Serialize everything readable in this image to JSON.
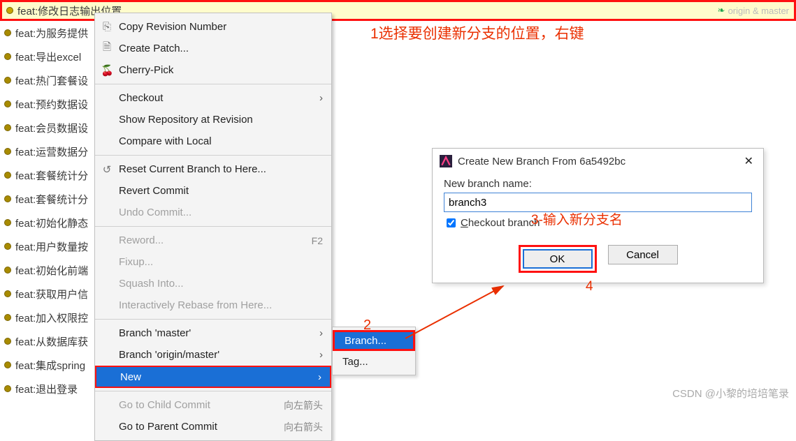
{
  "commits": [
    "feat:修改日志输出位置",
    "feat:为服务提供",
    "feat:导出excel",
    "feat:热门套餐设",
    "feat:预约数据设",
    "feat:会员数据设",
    "feat:运营数据分",
    "feat:套餐统计分",
    "feat:套餐统计分",
    "feat:初始化静态",
    "feat:用户数量按",
    "feat:初始化前端",
    "feat:获取用户信",
    "feat:加入权限控",
    "feat:从数据库获",
    "feat:集成spring",
    "feat:退出登录"
  ],
  "branch_tag": "origin & master",
  "annotations": {
    "a1": "1选择要创建新分支的位置，右键",
    "a2": "2",
    "a3": "3-输入新分支名",
    "a4": "4"
  },
  "menu": {
    "copy_revision": "Copy Revision Number",
    "create_patch": "Create Patch...",
    "cherry_pick": "Cherry-Pick",
    "checkout": "Checkout",
    "show_repo": "Show Repository at Revision",
    "compare_local": "Compare with Local",
    "reset_branch": "Reset Current Branch to Here...",
    "revert_commit": "Revert Commit",
    "undo_commit": "Undo Commit...",
    "reword": "Reword...",
    "reword_sc": "F2",
    "fixup": "Fixup...",
    "squash": "Squash Into...",
    "interactive_rebase": "Interactively Rebase from Here...",
    "branch_master": "Branch 'master'",
    "branch_origin_master": "Branch 'origin/master'",
    "new": "New",
    "go_child": "Go to Child Commit",
    "go_child_sc": "向左箭头",
    "go_parent": "Go to Parent Commit",
    "go_parent_sc": "向右箭头"
  },
  "submenu": {
    "branch": "Branch...",
    "tag": "Tag..."
  },
  "dialog": {
    "title": "Create New Branch From 6a5492bc",
    "label": "New branch name:",
    "value": "branch3",
    "checkbox": "heckout branch",
    "checkbox_prefix": "C",
    "ok": "OK",
    "cancel": "Cancel"
  },
  "watermark": "CSDN @小黎的培培笔录"
}
